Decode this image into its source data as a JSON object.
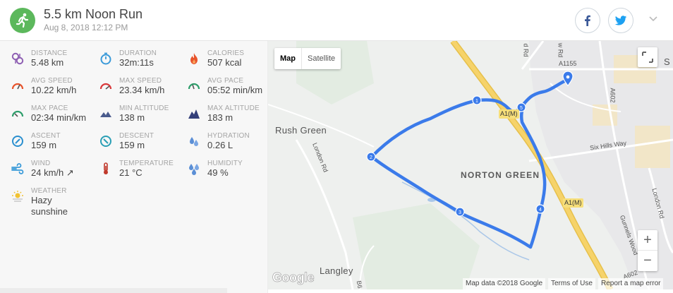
{
  "activity": {
    "title": "5.5 km Noon Run",
    "date": "Aug 8, 2018 12:12 PM"
  },
  "stats": [
    {
      "label": "DISTANCE",
      "value": "5.48 km",
      "icon": "distance-pin-icon",
      "color": "#8e5fb3"
    },
    {
      "label": "DURATION",
      "value": "32m:11s",
      "icon": "stopwatch-icon",
      "color": "#3a9ad9"
    },
    {
      "label": "CALORIES",
      "value": "507 kcal",
      "icon": "flame-icon",
      "color": "#e8542c"
    },
    {
      "label": "AVG SPEED",
      "value": "10.22 km/h",
      "icon": "speedometer-icon",
      "color": "#e8542c"
    },
    {
      "label": "MAX SPEED",
      "value": "23.34 km/h",
      "icon": "speedometer-icon",
      "color": "#d9383a"
    },
    {
      "label": "AVG PACE",
      "value": "05:52 min/km",
      "icon": "pace-gauge-icon",
      "color": "#2e9e6b"
    },
    {
      "label": "MAX PACE",
      "value": "02:34 min/km",
      "icon": "pace-gauge-icon",
      "color": "#2e9e6b"
    },
    {
      "label": "MIN ALTITUDE",
      "value": "138 m",
      "icon": "mountain-icon",
      "color": "#4a5b8c"
    },
    {
      "label": "MAX ALTITUDE",
      "value": "183 m",
      "icon": "mountain-icon",
      "color": "#34407a"
    },
    {
      "label": "ASCENT",
      "value": "159 m",
      "icon": "ascent-compass-icon",
      "color": "#2a8fcf"
    },
    {
      "label": "DESCENT",
      "value": "159 m",
      "icon": "descent-compass-icon",
      "color": "#2a9fb5"
    },
    {
      "label": "HYDRATION",
      "value": "0.26 L",
      "icon": "water-drops-icon",
      "color": "#5b8fd6"
    },
    {
      "label": "WIND",
      "value": "24 km/h ↗",
      "icon": "wind-icon",
      "color": "#3a9ad9"
    },
    {
      "label": "TEMPERATURE",
      "value": "21 °C",
      "icon": "thermometer-icon",
      "color": "#c0392b"
    },
    {
      "label": "HUMIDITY",
      "value": "49 %",
      "icon": "humidity-drops-icon",
      "color": "#5b8fd6"
    },
    {
      "label": "WEATHER",
      "value": "Hazy",
      "value2": "sunshine",
      "icon": "sun-haze-icon",
      "color": "#f1c232"
    }
  ],
  "map": {
    "type_map": "Map",
    "type_satellite": "Satellite",
    "labels": {
      "rush_green": "Rush Green",
      "norton_green": "NORTON GREEN",
      "langley": "Langley",
      "london_rd_left": "London Rd",
      "six_hills_way": "Six Hills Way",
      "london_rd_right": "London Rd",
      "gunnels_wood": "Gunnels Wood",
      "a602_top": "A602",
      "a602_bottom": "A602",
      "a1155": "A1155",
      "a1m_top": "A1(M)",
      "a1m_mid": "A1(M)",
      "road_rd1": "d Rd",
      "road_rd2": "w Rd",
      "b_road": "B6",
      "edge_s": "S"
    },
    "markers": [
      "1",
      "2",
      "3",
      "4",
      "5"
    ],
    "logo": "Google",
    "attribution": "Map data ©2018 Google",
    "terms": "Terms of Use",
    "report": "Report a map error",
    "zoom_in": "+",
    "zoom_out": "−"
  },
  "colors": {
    "route": "#3b7bea",
    "badge": "#5cb85c",
    "facebook": "#3b5998",
    "twitter": "#1da1f2",
    "motorway": "#f6d36a"
  }
}
